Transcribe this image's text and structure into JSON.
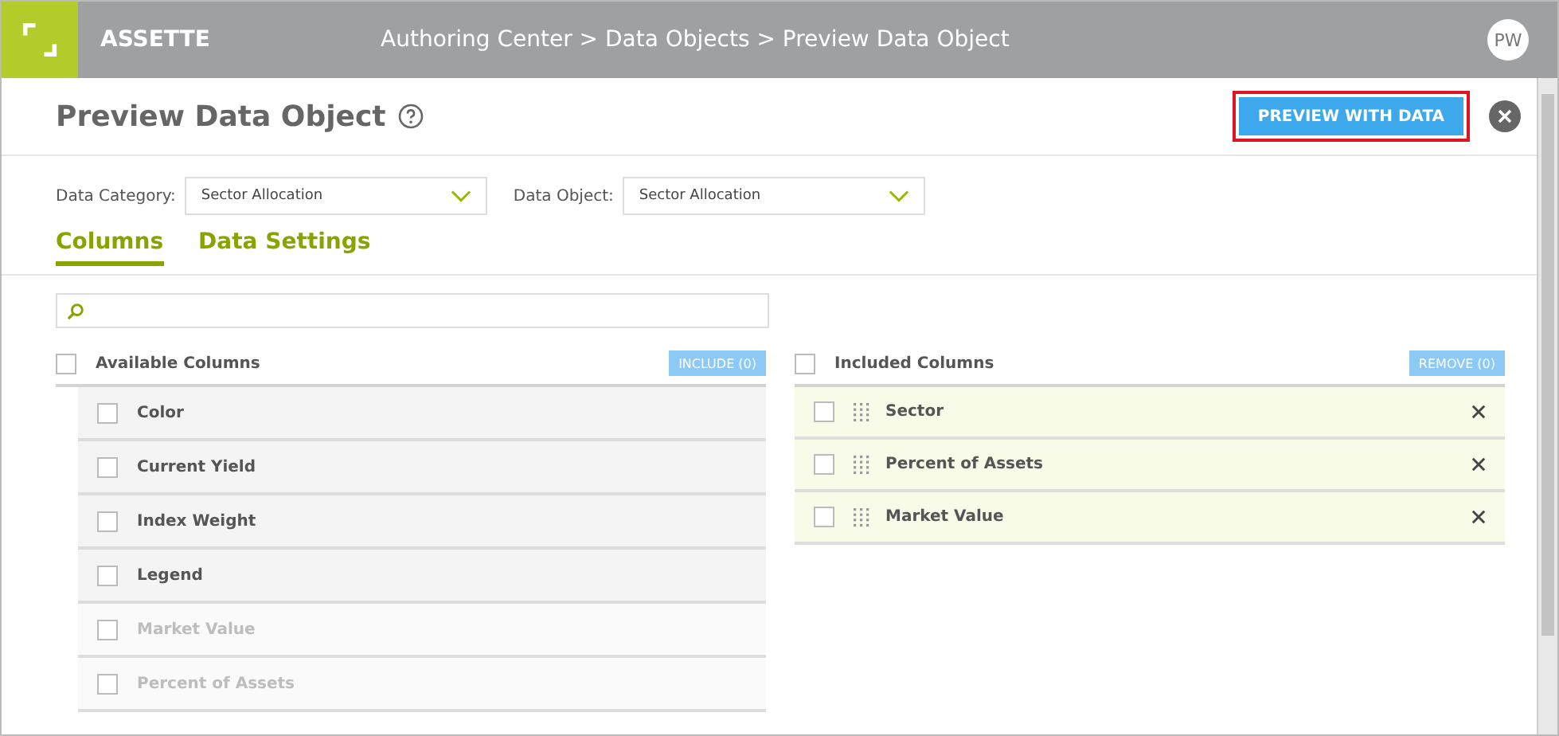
{
  "header": {
    "brand": "ASSETTE",
    "breadcrumb": "Authoring Center > Data Objects > Preview Data Object",
    "avatar": "PW"
  },
  "page": {
    "title": "Preview Data Object",
    "primary_button": {
      "label": "PREVIEW WITH DATA",
      "highlighted": true
    }
  },
  "filters": [
    {
      "label": "Data Category:",
      "value": "Sector Allocation"
    },
    {
      "label": "Data Object:",
      "value": "Sector Allocation"
    }
  ],
  "tabs": [
    {
      "label": "Columns",
      "selected": true
    },
    {
      "label": "Data Settings",
      "selected": false
    }
  ],
  "available": {
    "title": "Available Columns",
    "checked": false,
    "button": "INCLUDE (0)",
    "items": [
      {
        "label": "Color",
        "checked": false,
        "disabled": false
      },
      {
        "label": "Current Yield",
        "checked": false,
        "disabled": false
      },
      {
        "label": "Index Weight",
        "checked": false,
        "disabled": false
      },
      {
        "label": "Legend",
        "checked": false,
        "disabled": false
      },
      {
        "label": "Market Value",
        "checked": false,
        "disabled": true
      },
      {
        "label": "Percent of Assets",
        "checked": false,
        "disabled": true
      }
    ]
  },
  "included": {
    "title": "Included Columns",
    "checked": false,
    "button": "REMOVE (0)",
    "items": [
      {
        "label": "Sector",
        "checked": false
      },
      {
        "label": "Percent of Assets",
        "checked": false
      },
      {
        "label": "Market Value",
        "checked": false
      }
    ]
  }
}
